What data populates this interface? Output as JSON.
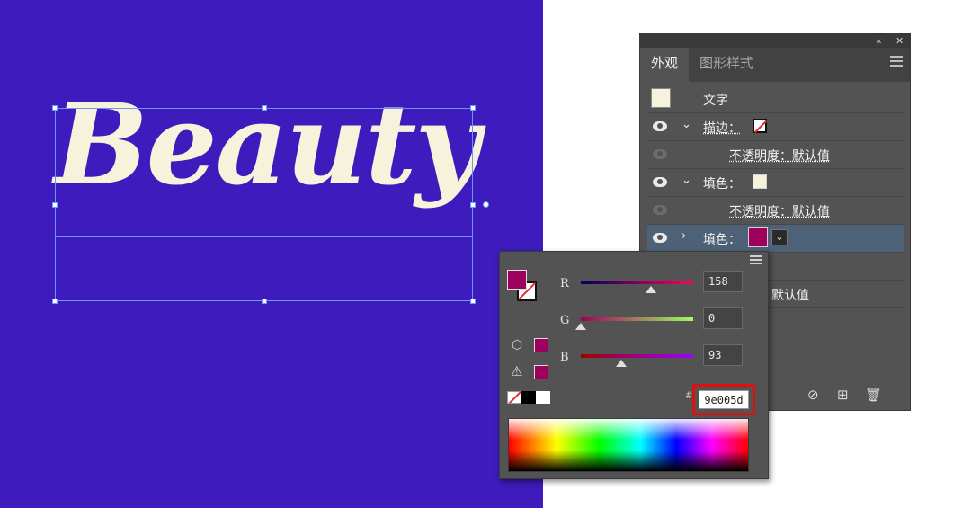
{
  "artwork": {
    "text": "Beauty",
    "background_color": "#3d1bbc",
    "text_color": "#f6f2dc"
  },
  "appearance_panel": {
    "tabs": [
      "外观",
      "图形样式"
    ],
    "active_tab": "外观",
    "collapse_glyph": "«",
    "close_glyph": "✕",
    "rows": [
      {
        "label": "文字"
      },
      {
        "label": "描边："
      },
      {
        "label": "不透明度：默认值"
      },
      {
        "label": "填色："
      },
      {
        "label": "不透明度：默认值"
      },
      {
        "label": "填色："
      },
      {
        "label": "默认值"
      }
    ],
    "caret_open": "⌄",
    "caret_closed": "›",
    "dropdown_glyph": "⌄",
    "selected_row_color": "#4d6177"
  },
  "color_picker": {
    "channels": [
      {
        "label": "R",
        "value": "158",
        "fraction": 0.62
      },
      {
        "label": "G",
        "value": "0",
        "fraction": 0.0
      },
      {
        "label": "B",
        "value": "93",
        "fraction": 0.36
      }
    ],
    "hash": "#",
    "hex_value": "9e005d",
    "fill_color": "#9e005d",
    "highlight_color": "#e10e0e"
  }
}
